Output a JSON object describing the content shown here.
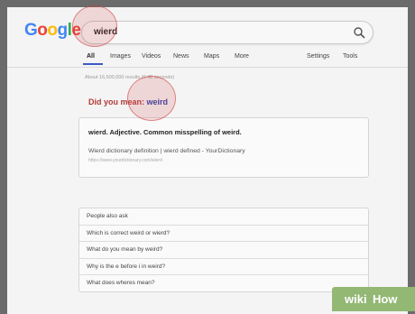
{
  "logo": {
    "letters": [
      "G",
      "o",
      "o",
      "g",
      "l",
      "e"
    ],
    "colors": [
      "#4285f4",
      "#ea4335",
      "#fbbc05",
      "#4285f4",
      "#34a853",
      "#ea4335"
    ]
  },
  "search": {
    "query": "wierd",
    "icon": "search-icon"
  },
  "tabs": [
    "All",
    "Images",
    "Videos",
    "News",
    "Maps",
    "More"
  ],
  "tools": [
    "Settings",
    "Tools"
  ],
  "stats": "About 16,500,000 results (0.48 seconds)",
  "did_you_mean": {
    "prefix": "Did you mean:",
    "suggestion": "weird"
  },
  "result": {
    "definition": "wierd. Adjective. Common misspelling of weird.",
    "title": "Wierd dictionary definition  |  wierd defined - YourDictionary",
    "url": "https://www.yourdictionary.com/wierd"
  },
  "people_also_ask": {
    "heading": "People also ask",
    "questions": [
      "Which is correct weird or wierd?",
      "What do you mean by weird?",
      "Why is the e before i in weird?",
      "What does wheres mean?"
    ]
  },
  "watermark": {
    "wiki": "wiki",
    "how": "How"
  }
}
